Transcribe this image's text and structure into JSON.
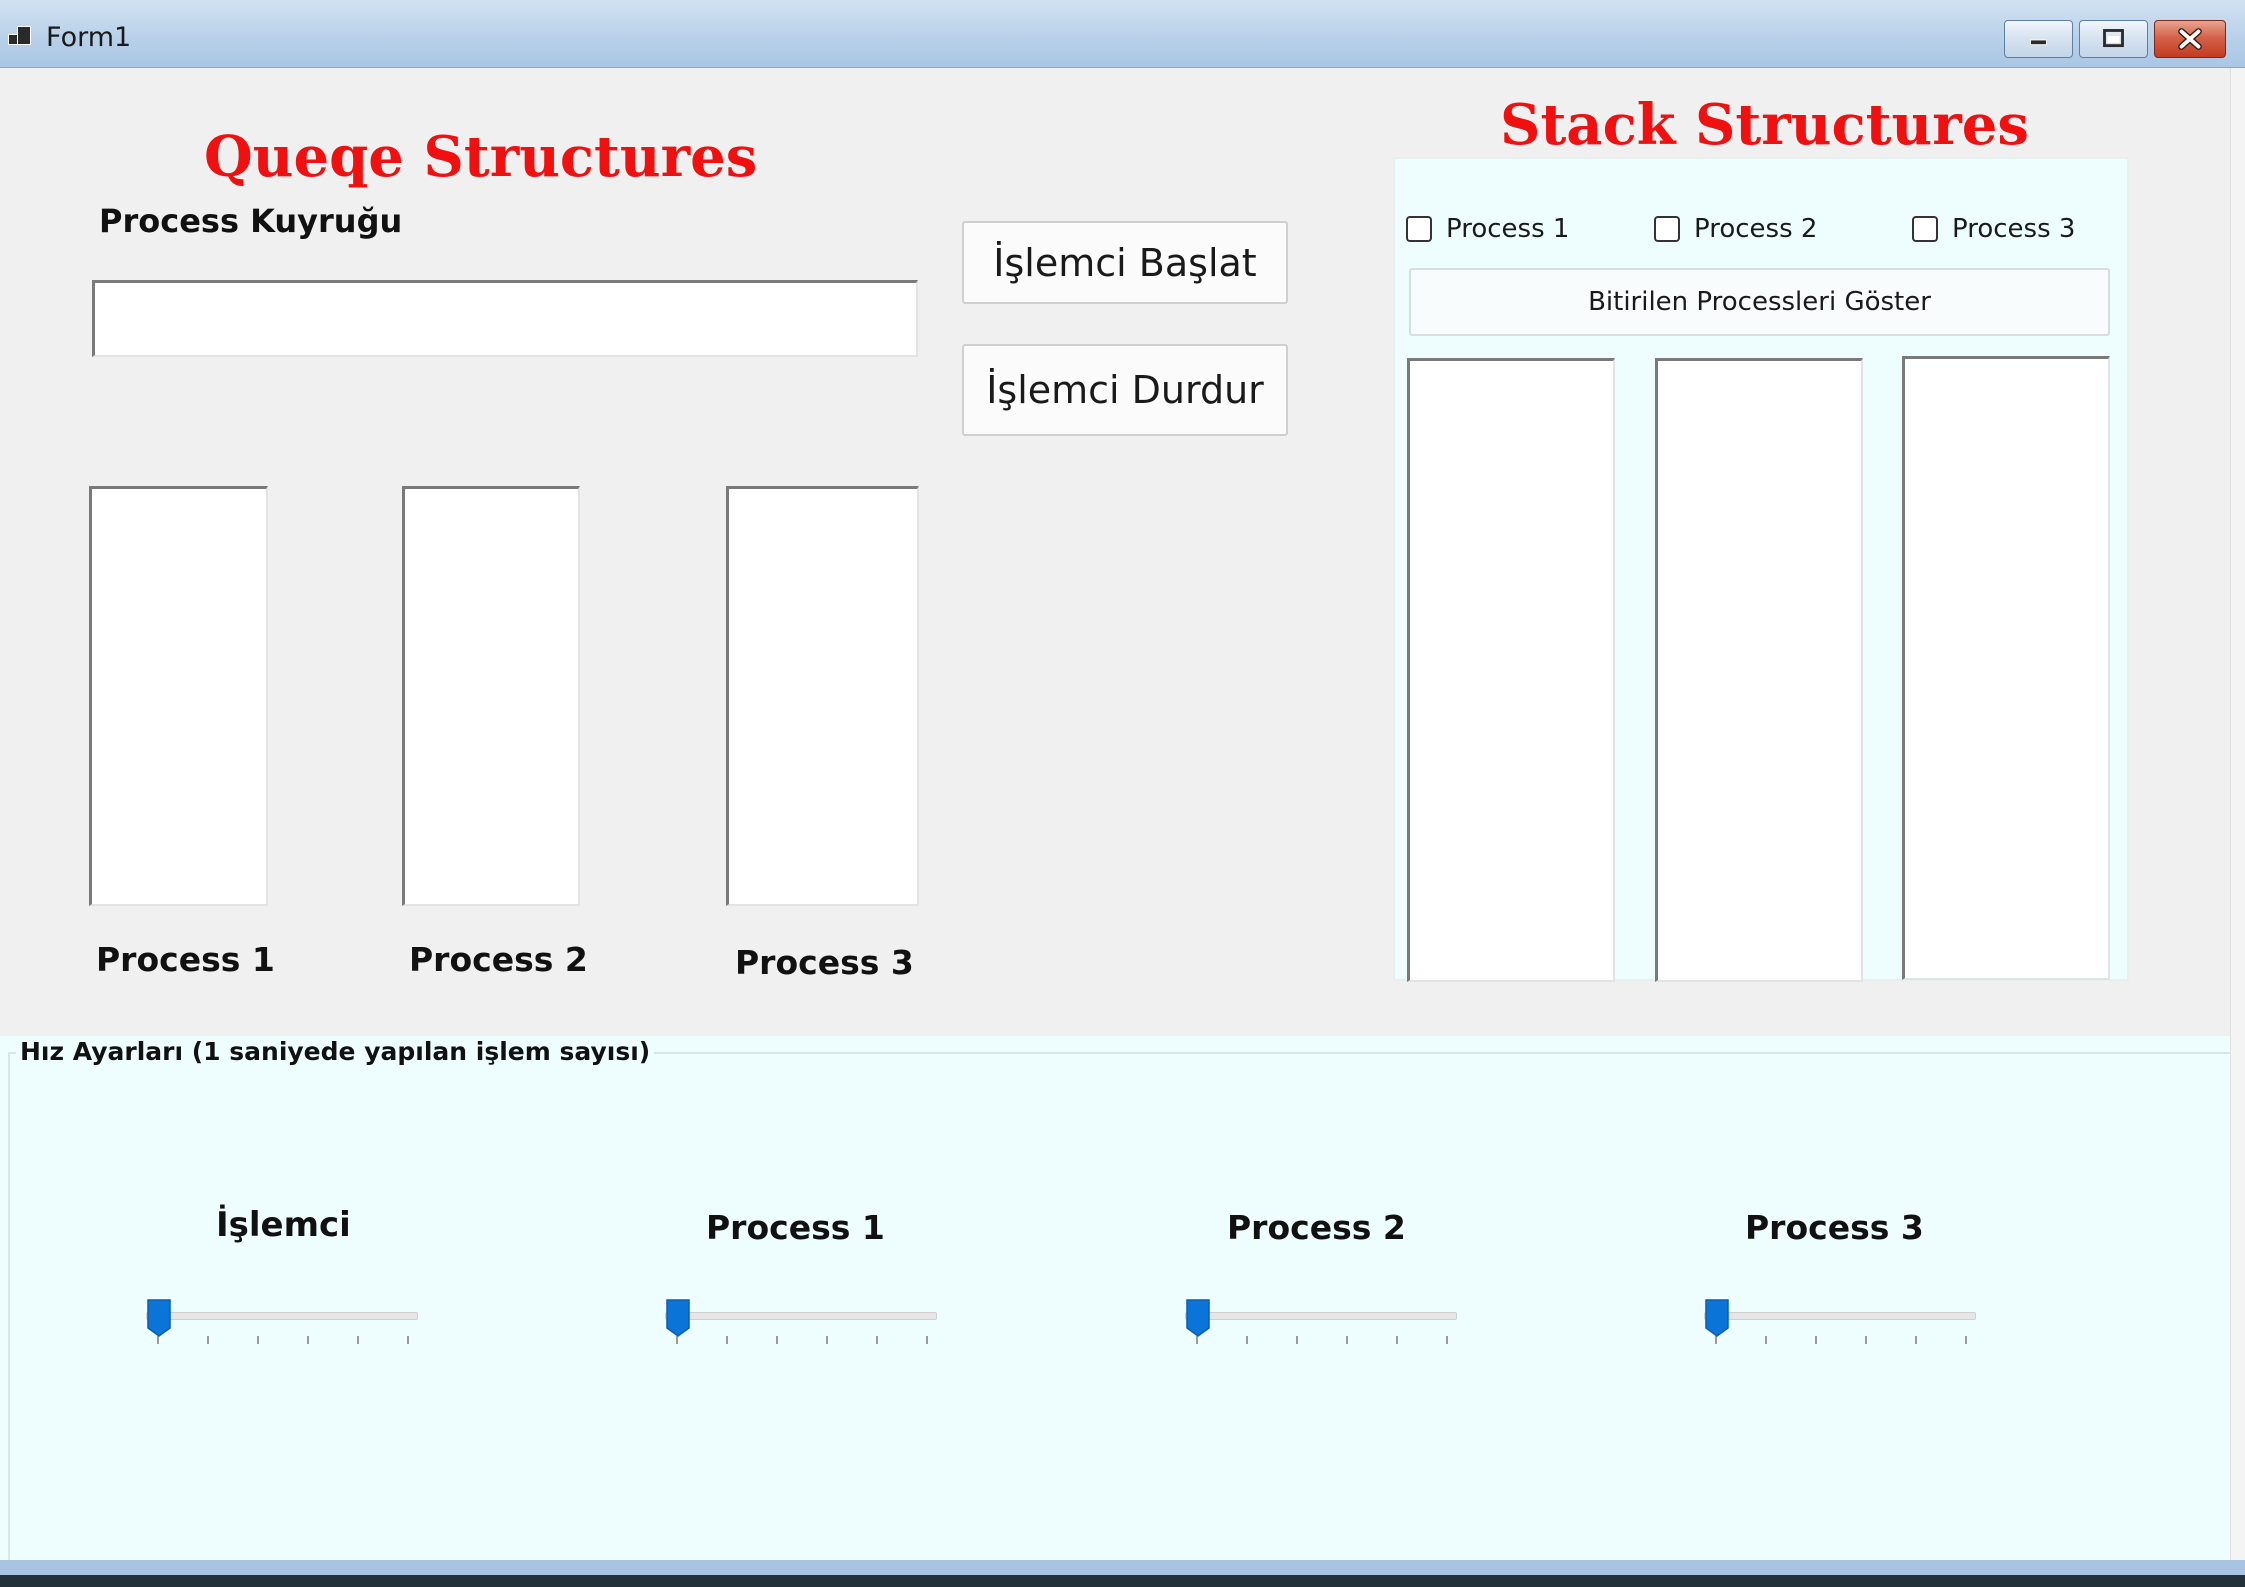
{
  "window": {
    "title": "Form1"
  },
  "queue": {
    "heading": "Queqe Structures",
    "queue_label": "Process Kuyruğu",
    "queue_value": "",
    "lists": [
      {
        "label": "Process 1"
      },
      {
        "label": "Process 2"
      },
      {
        "label": "Process 3"
      }
    ]
  },
  "controls": {
    "start_label": "İşlemci Başlat",
    "stop_label": "İşlemci Durdur"
  },
  "stack": {
    "heading": "Stack Structures",
    "checkboxes": [
      {
        "label": "Process 1",
        "checked": false
      },
      {
        "label": "Process 2",
        "checked": false
      },
      {
        "label": "Process 3",
        "checked": false
      }
    ],
    "show_finished_label": "Bitirilen Processleri Göster"
  },
  "speed": {
    "group_title": "Hız Ayarları (1 saniyede yapılan işlem sayısı)",
    "sliders": [
      {
        "label": "İşlemci",
        "value": 0,
        "min": 0,
        "max": 5
      },
      {
        "label": "Process 1",
        "value": 0,
        "min": 0,
        "max": 5
      },
      {
        "label": "Process 2",
        "value": 0,
        "min": 0,
        "max": 5
      },
      {
        "label": "Process 3",
        "value": 0,
        "min": 0,
        "max": 5
      }
    ]
  },
  "colors": {
    "heading_red": "#f01010",
    "panel_bg": "#eefefe",
    "slider_thumb": "#0a74d8"
  },
  "icons": {
    "app": "app-window-icon",
    "minimize": "minimize-icon",
    "maximize": "maximize-icon",
    "close": "close-icon"
  }
}
